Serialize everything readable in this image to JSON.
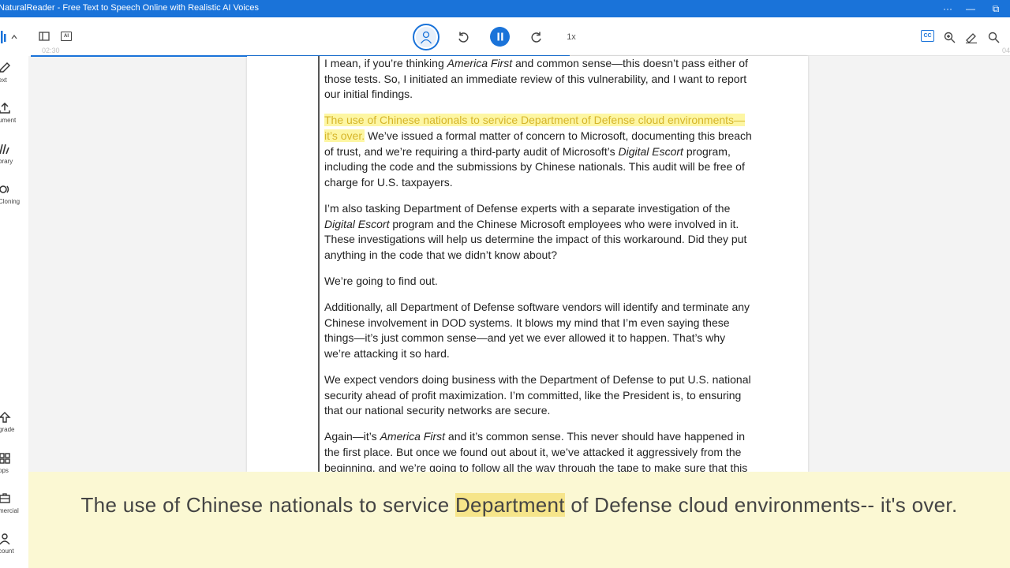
{
  "window": {
    "title": "NaturalReader - Free Text to Speech Online with Realistic AI Voices",
    "controls": [
      "···",
      "—",
      "⧉"
    ]
  },
  "toolbar": {
    "time_elapsed": "02:30",
    "time_total": "04",
    "progress": 0.55,
    "speed_label": "1x",
    "cc_label": "CC",
    "ai_label": "AI"
  },
  "sidebar": {
    "items": [
      {
        "label": "ext",
        "icon": "edit-icon"
      },
      {
        "label": "ument",
        "icon": "upload-icon"
      },
      {
        "label": "brary",
        "icon": "library-icon"
      },
      {
        "label": "Cloning",
        "icon": "voice-cloning-icon"
      },
      {
        "label": "grade",
        "icon": "upgrade-icon"
      },
      {
        "label": "pps",
        "icon": "apps-grid-icon"
      },
      {
        "label": "mercial",
        "icon": "commercial-icon"
      },
      {
        "label": "count",
        "icon": "account-icon"
      }
    ]
  },
  "document": {
    "p1_a": "I mean, if you’re thinking ",
    "p1_em": "America First",
    "p1_b": " and common sense—this doesn’t pass either of those tests. So, I initiated an immediate review of this vulnerability, and I want to report our initial findings.",
    "p2_hl": "The use of Chinese nationals to service Department of Defense cloud environments—it’s over.",
    "p2_a": " We’ve issued a formal matter of concern to Microsoft, documenting this breach of trust, and we’re requiring a third-party audit of Microsoft’s ",
    "p2_em": "Digital Escort",
    "p2_b": " program, including the code and the submissions by Chinese nationals. This audit will be free of charge for U.S. taxpayers.",
    "p3_a": "I’m also tasking Department of Defense experts with a separate investigation of the ",
    "p3_em": "Digital Escort",
    "p3_b": " program and the Chinese Microsoft employees who were involved in it. These investigations will help us determine the impact of this workaround. Did they put anything in the code that we didn’t know about?",
    "p4": "We’re going to find out.",
    "p5": "Additionally, all Department of Defense software vendors will identify and terminate any Chinese involvement in DOD systems. It blows my mind that I’m even saying these things—it’s just common sense—and yet we ever allowed it to happen. That’s why we’re attacking it so hard.",
    "p6": "We expect vendors doing business with the Department of Defense to put U.S. national security ahead of profit maximization. I’m committed, like the President is, to ensuring that our national security networks are secure.",
    "p7_a": "Again—it’s ",
    "p7_em": "America First",
    "p7_b": " and it’s common sense. This never should have happened in the first place. But once we found out about it, we’ve attacked it aggressively from the beginning, and we’re going to follow all the way through the tape to make sure that this"
  },
  "subtitle": {
    "before": "The use of Chinese nationals to service ",
    "current_word": "Department",
    "after": " of Defense cloud environments-- it's over."
  },
  "colors": {
    "accent": "#1a73d9",
    "highlight": "#fdf6a3",
    "subtitle_bg": "#fbf8d3"
  }
}
